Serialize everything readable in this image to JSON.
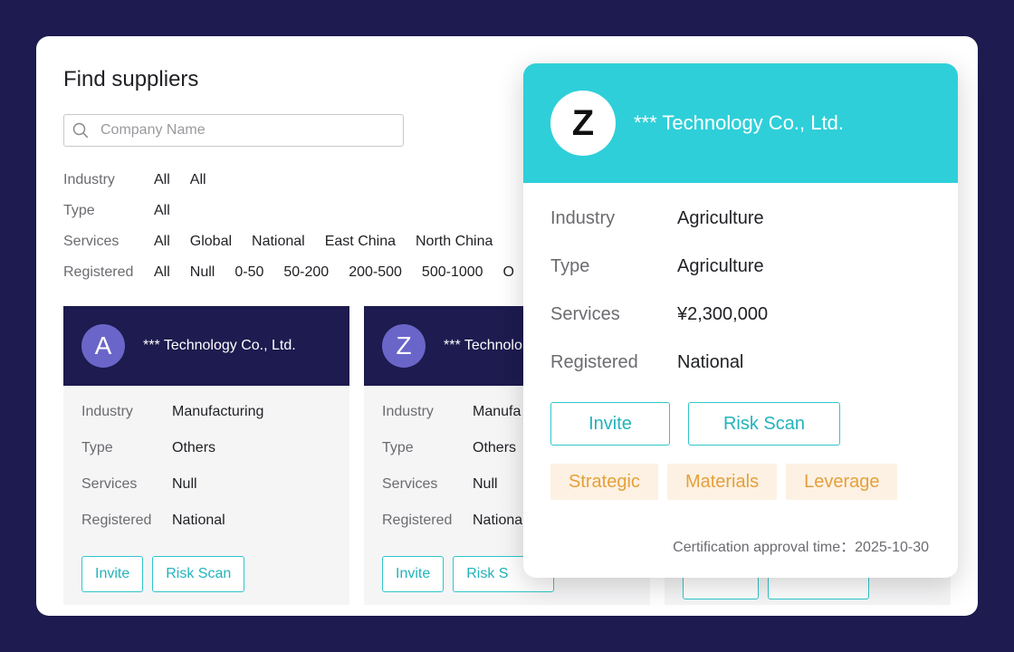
{
  "page": {
    "title": "Find suppliers"
  },
  "search": {
    "placeholder": "Company Name",
    "icon": "search-icon"
  },
  "filters": [
    {
      "label": "Industry",
      "options": [
        "All",
        "All"
      ]
    },
    {
      "label": "Type",
      "options": [
        "All"
      ]
    },
    {
      "label": "Services",
      "options": [
        "All",
        "Global",
        "National",
        "East China",
        "North China"
      ]
    },
    {
      "label": "Registered",
      "options": [
        "All",
        "Null",
        "0-50",
        "50-200",
        "200-500",
        "500-1000",
        "O"
      ]
    }
  ],
  "cards": [
    {
      "initial": "A",
      "name": "*** Technology Co., Ltd.",
      "fields": [
        {
          "k": "Industry",
          "v": "Manufacturing"
        },
        {
          "k": "Type",
          "v": "Others"
        },
        {
          "k": "Services",
          "v": "Null"
        },
        {
          "k": "Registered",
          "v": "National"
        }
      ],
      "invite": "Invite",
      "risk": "Risk Scan"
    },
    {
      "initial": "Z",
      "name": "*** Technolo",
      "fields": [
        {
          "k": "Industry",
          "v": "Manufa"
        },
        {
          "k": "Type",
          "v": "Others"
        },
        {
          "k": "Services",
          "v": "Null"
        },
        {
          "k": "Registered",
          "v": "Nationa"
        }
      ],
      "invite": "Invite",
      "risk": "Risk S"
    }
  ],
  "popup": {
    "initial": "Z",
    "name": "*** Technology Co., Ltd.",
    "fields": [
      {
        "k": "Industry",
        "v": "Agriculture"
      },
      {
        "k": "Type",
        "v": "Agriculture"
      },
      {
        "k": "Services",
        "v": "¥2,300,000"
      },
      {
        "k": "Registered",
        "v": "National"
      }
    ],
    "invite": "Invite",
    "risk": "Risk Scan",
    "tags": [
      "Strategic",
      "Materials",
      "Leverage"
    ],
    "cert_label": "Certification approval time：",
    "cert_date": "2025-10-30"
  },
  "colors": {
    "background": "#1d1b4f",
    "card_header": "#1d1b4f",
    "avatar": "#6a66c9",
    "popup_header": "#2ecfd9",
    "accent": "#2ec6cc",
    "tag_bg": "#fdf1e3",
    "tag_text": "#e5a03a"
  }
}
